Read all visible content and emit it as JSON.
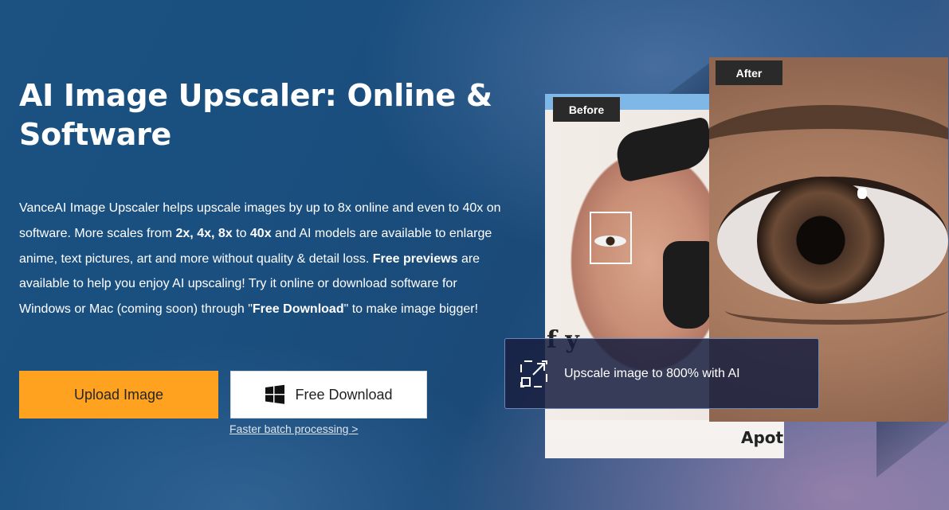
{
  "hero": {
    "title": "AI Image Upscaler: Online & Software",
    "desc_parts": {
      "p1": "VanceAI Image Upscaler helps upscale images by up to 8x online and even to 40x on software. More scales from ",
      "b1": "2x, 4x, 8x",
      "p2": " to ",
      "b2": "40x",
      "p3": " and AI models are available to enlarge anime, text pictures, art and more without quality & detail loss. ",
      "b3": "Free previews",
      "p4": " are available to help you enjoy AI upscaling! Try it online or download software for Windows or Mac (coming soon) through \"",
      "b4": "Free Download",
      "p5": "\" to make image bigger!"
    }
  },
  "actions": {
    "upload_label": "Upload Image",
    "download_label": "Free Download",
    "batch_link": "Faster batch processing >"
  },
  "visual": {
    "before_label": "Before",
    "after_label": "After",
    "before_text_1": "f y",
    "before_text_2": "Apot",
    "upscale_text": "Upscale image to 800% with AI"
  },
  "icons": {
    "download_icon": "windows-icon",
    "upscale_icon": "expand-icon"
  },
  "colors": {
    "upload_button": "#ffa21f",
    "download_button": "#ffffff",
    "label_tag": "#2a2a2a"
  }
}
